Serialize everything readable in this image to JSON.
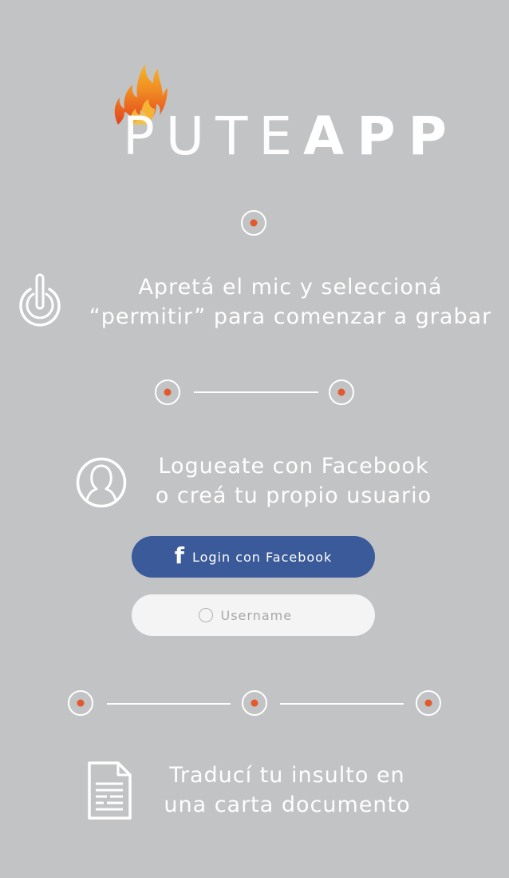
{
  "brand": {
    "logo_light": "PUTE",
    "logo_bold": "APP"
  },
  "colors": {
    "background": "#c2c3c5",
    "accent_dot": "#e25a2c",
    "facebook_blue": "#3b5a9a",
    "input_bg": "#f4f4f4",
    "text": "#ffffff"
  },
  "steps": [
    {
      "icon": "power-icon",
      "line1": "Apretá el mic y seleccioná",
      "line2": "“permitir” para comenzar a grabar"
    },
    {
      "icon": "user-icon",
      "line1": "Logueate con Facebook",
      "line2": "o creá tu propio usuario"
    },
    {
      "icon": "document-icon",
      "line1": "Traducí tu insulto en",
      "line2": "una carta documento"
    }
  ],
  "login": {
    "facebook_label": "Login con Facebook",
    "facebook_icon": "f",
    "username_placeholder": "Username",
    "username_value": ""
  }
}
